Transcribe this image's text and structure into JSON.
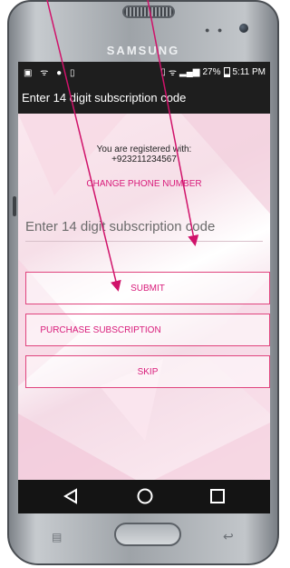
{
  "device": {
    "brand": "SAMSUNG"
  },
  "status_bar": {
    "battery": "27%",
    "time": "5:11 PM"
  },
  "app_bar": {
    "title": "Enter 14 digit subscription code"
  },
  "registration": {
    "label": "You are registered with:",
    "phone": "+923211234567",
    "change_link": "CHANGE PHONE NUMBER"
  },
  "code_input": {
    "placeholder": "Enter 14 digit subscription code",
    "value": ""
  },
  "buttons": {
    "submit": "SUBMIT",
    "purchase": "PURCHASE SUBSCRIPTION",
    "skip": "SKIP"
  },
  "colors": {
    "accent": "#d81b7a",
    "bar": "#1e1e1e",
    "annotation": "#d0126a"
  },
  "icons": [
    "back-triangle-icon",
    "home-circle-icon",
    "recents-square-icon"
  ]
}
